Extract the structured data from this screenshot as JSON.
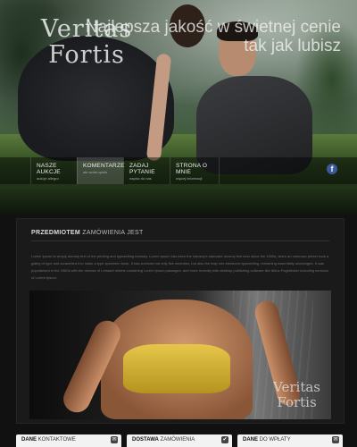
{
  "hero": {
    "logo_line1": "Veritas",
    "logo_line2": "Fortis",
    "tagline_line1": "Najlepsza jakość w świetnej cenie",
    "tagline_line2": "tak jak lubisz"
  },
  "nav": {
    "items": [
      {
        "label": "NASZE AUKCJE",
        "sub": "aukcje allegro"
      },
      {
        "label": "KOMENTARZE",
        "sub": "ale wolał opinie"
      },
      {
        "label": "ZADAJ PYTANIE",
        "sub": "napisz do nas"
      },
      {
        "label": "STRONA O MNIE",
        "sub": "więcej informacji"
      }
    ],
    "facebook_glyph": "f"
  },
  "content": {
    "title_bold": "PRZEDMIOTEM",
    "title_rest": " ZAMÓWIENIA JEST",
    "lorem": "Lorem Ipsum is simply dummy text of the printing and typesetting industry. Lorem Ipsum has been the industry's standard dummy text ever since the 1500s, when an unknown printer took a galley of type and scrambled it to make a type specimen book. It has survived not only five centuries, but also the leap into electronic typesetting, remaining essentially unchanged. It was popularised in the 1960s with the release of Letraset sheets containing Lorem Ipsum passages, and more recently with desktop publishing software like Aldus PageMaker including versions of Lorem Ipsum.",
    "watermark_line1": "Veritas",
    "watermark_line2": "Fortis"
  },
  "info_boxes": [
    {
      "bold": "DANE",
      "rest": " KONTAKTOWE",
      "icon": "✉"
    },
    {
      "bold": "DOSTAWA",
      "rest": " ZAMÓWIENIA",
      "icon": "✔"
    },
    {
      "bold": "DANE",
      "rest": " DO WPŁATY",
      "icon": "✉"
    }
  ]
}
